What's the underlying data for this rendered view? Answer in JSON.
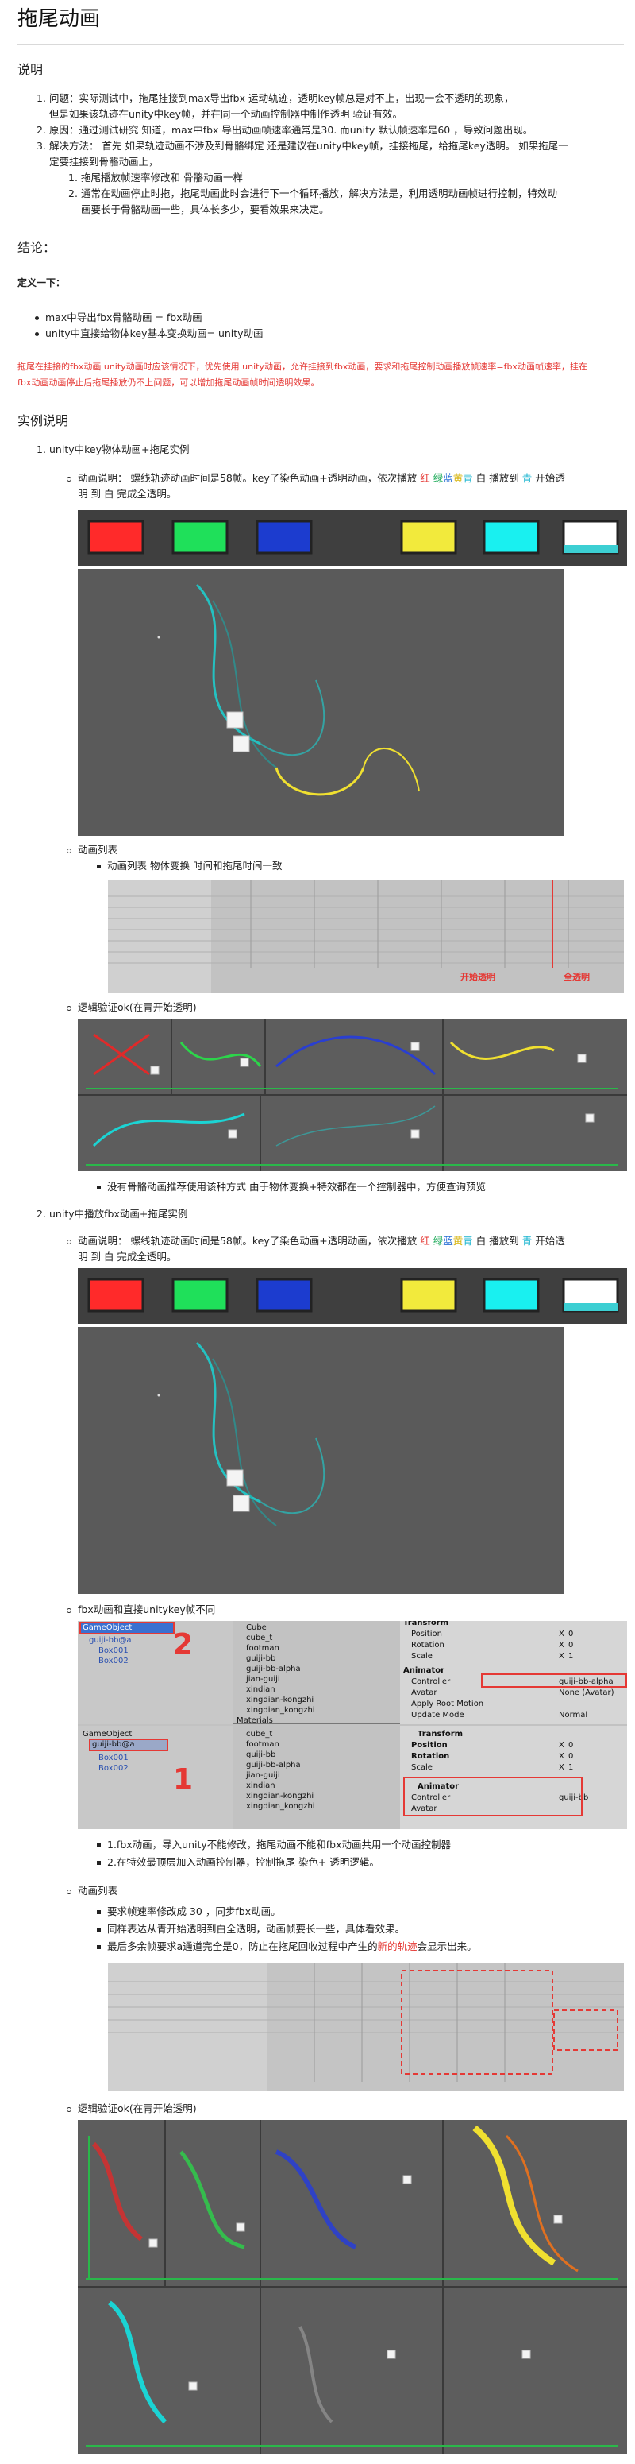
{
  "title": "拖尾动画",
  "sections": {
    "explain_heading": "说明",
    "conclusion_heading": "结论：",
    "examples_heading": "实例说明"
  },
  "explain": {
    "item1_num": "1.",
    "item1": "问题：实际测试中，拖尾挂接到max导出fbx 运动轨迹，透明key帧总是对不上，出现一会不透明的现象，",
    "item1b": "但是如果该轨迹在unity中key帧，并在同一个动画控制器中制作透明 验证有效。",
    "item2_num": "2.",
    "item2": "原因：通过测试研究 知道，max中fbx 导出动画帧速率通常是30. 而unity 默认帧速率是60 ，导致问题出现。",
    "item3_num": "3.",
    "item3": "解决方法：  首先 如果轨迹动画不涉及到骨骼绑定 还是建议在unity中key帧，挂接拖尾，给拖尾key透明。 如果拖尾一",
    "item3b": "定要挂接到骨骼动画上，",
    "sub1_num": "1.",
    "sub1": "拖尾播放帧速率修改和 骨骼动画一样",
    "sub2_num": "2.",
    "sub2": "通常在动画停止时拖，拖尾动画此时会进行下一个循环播放，解决方法是，利用透明动画帧进行控制，特效动",
    "sub2b": "画要长于骨骼动画一些，具体长多少，要看效果来决定。"
  },
  "definition": {
    "label": "定义一下：",
    "b1": "max中导出fbx骨骼动画 = fbx动画",
    "b2": "unity中直接给物体key基本变换动画= unity动画"
  },
  "warning": {
    "line1": "拖尾在挂接的fbx动画 unity动画时应该情况下，优先使用 unity动画，允许挂接到fbx动画，要求和拖尾控制动画播放帧速率=fbx动画帧速率，挂在",
    "line2": "fbx动画动画停止后拖尾播放仍不上问题，可以增加拖尾动画帧时间透明效果。"
  },
  "example1": {
    "num": "1.",
    "heading": "unity中key物体动画+拖尾实例",
    "desc_a": "动画说明：  螺线轨迹动画时间是58帧。key了染色动画+透明动画，依次播放 ",
    "c_red": "红",
    "c_green": "绿",
    "c_blue": "蓝",
    "c_yellow": "黄",
    "c_cyan": "青",
    "c_white": "白",
    "desc_b": " 播放到 ",
    "c_cyan2": "青",
    "desc_c": " 开始透",
    "desc_line2": "明 到 白 完成全透明。",
    "list_label": "动画列表",
    "list_bullet": "动画列表 物体变换 时间和拖尾时间一致",
    "anno_start": "开始透明",
    "anno_full": "全透明",
    "logic_label": "逻辑验证ok(在青开始透明)",
    "note": "没有骨骼动画推荐使用该种方式 由于物体变换+特效都在一个控制器中，方便查询预览"
  },
  "example2": {
    "num": "2.",
    "heading": "unity中播放fbx动画+拖尾实例",
    "desc_a": "动画说明：  螺线轨迹动画时间是58帧。key了染色动画+透明动画，依次播放 ",
    "desc_line2": "明 到 白 完成全透明。",
    "diff_label": "fbx动画和直接unitykey帧不同",
    "inspector": {
      "game_object": "GameObject",
      "guiji": "guiji-bb@a",
      "box1": "Box001",
      "box2": "Box002",
      "assets": [
        "Cube",
        "cube_t",
        "footman",
        "guiji-bb",
        "guiji-bb-alpha",
        "jian-guiji",
        "xindian",
        "xingdian-kongzhi",
        "xingdian_kongzhi"
      ],
      "materials": "Materials",
      "transform": "Transform",
      "position": "Position",
      "rotation": "Rotation",
      "scale": "Scale",
      "animator": "Animator",
      "controller": "Controller",
      "controller_val1": "guiji-bb-alpha",
      "controller_val2": "guiji-bb",
      "avatar": "Avatar",
      "avatar_val": "None (Avatar)",
      "apply_root": "Apply Root Motion",
      "update_mode": "Update Mode",
      "update_val": "Normal",
      "x": "X",
      "zero": "0",
      "one": "1",
      "big1": "1",
      "big2": "2"
    },
    "fbx_note1": "1.fbx动画，导入unity不能修改，拖尾动画不能和fbx动画共用一个动画控制器",
    "fbx_note2": "2.在特效最顶层加入动画控制器，控制拖尾 染色+ 透明逻辑。",
    "list_label": "动画列表",
    "list_b1": "要求帧速率修改成 30 ，同步fbx动画。",
    "list_b2": "同样表达从青开始透明到白全透明，动画帧要长一些，具体看效果。",
    "list_b3a": "最后多余帧要求a通道完全是0，防止在拖尾回收过程中产生的",
    "list_b3red": "新的轨迹",
    "list_b3b": "会显示出来。",
    "logic_label": "逻辑验证ok(在青开始透明)"
  },
  "colors": {
    "red": "#ff2a2a",
    "green": "#1fe05a",
    "blue": "#1c3ccf",
    "yellow": "#f2ea3c",
    "cyan": "#19f0f0",
    "white": "#ffffff",
    "warning": "#e53935"
  }
}
